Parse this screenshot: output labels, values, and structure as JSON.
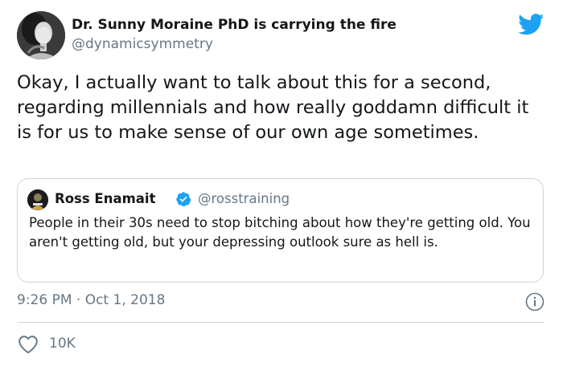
{
  "tweet": {
    "author_name": "Dr. Sunny Moraine PhD is carrying the fire",
    "author_handle": "@dynamicsymmetry",
    "text": "Okay, I actually want to talk about this for a second, regarding millennials and how really goddamn difficult it is for us to make sense of our own age sometimes.",
    "timestamp": "9:26 PM · Oct 1, 2018",
    "like_count": "10K"
  },
  "quoted_tweet": {
    "author_name": "Ross Enamait",
    "author_handle": "@rosstraining",
    "text": "People in their 30s need to stop bitching about how they're getting old. You aren't getting old, but your depressing outlook sure as hell is."
  },
  "icons": {
    "logo": "twitter-bird-icon",
    "verified": "verified-badge-icon",
    "info": "info-icon",
    "like": "heart-icon"
  },
  "colors": {
    "twitter_blue": "#1da1f2",
    "text_primary": "#14171a",
    "text_secondary": "#657786",
    "border": "#ccd6dd"
  }
}
